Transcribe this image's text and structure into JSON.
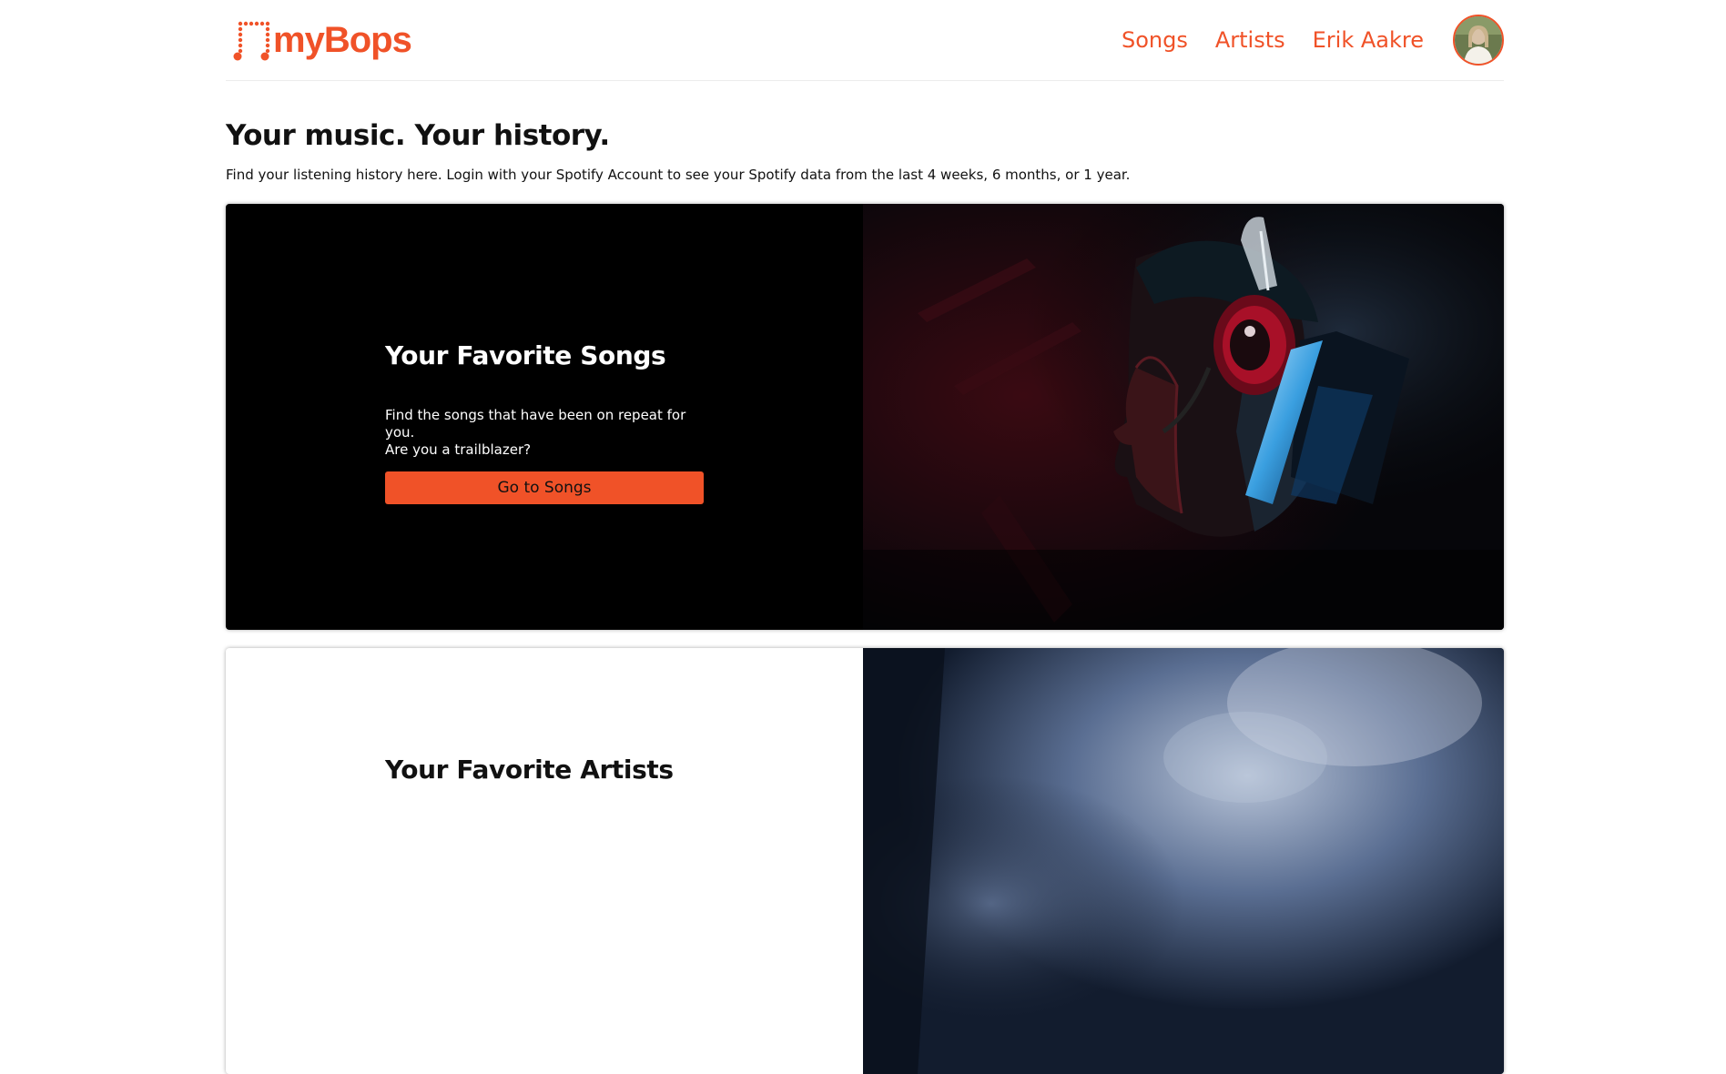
{
  "brand": {
    "name": "myBops",
    "color": "#f05228"
  },
  "nav": {
    "songs_label": "Songs",
    "artists_label": "Artists",
    "user_label": "Erik Aakre"
  },
  "hero": {
    "title": "Your music. Your history.",
    "subtitle": "Find your listening history here. Login with your Spotify Account to see your Spotify data from the last 4 weeks, 6 months, or 1 year."
  },
  "cards": [
    {
      "title": "Your Favorite Songs",
      "description_line1": "Find the songs that have been on repeat for you.",
      "description_line2": "Are you a trailblazer?",
      "button_label": "Go to Songs",
      "image": "man-with-red-headphones-photo"
    },
    {
      "title": "Your Favorite Artists",
      "image": "smoky-concert-stage-photo"
    }
  ],
  "icons": {
    "logo": "music-note-dots-icon",
    "avatar": "user-avatar-photo"
  }
}
